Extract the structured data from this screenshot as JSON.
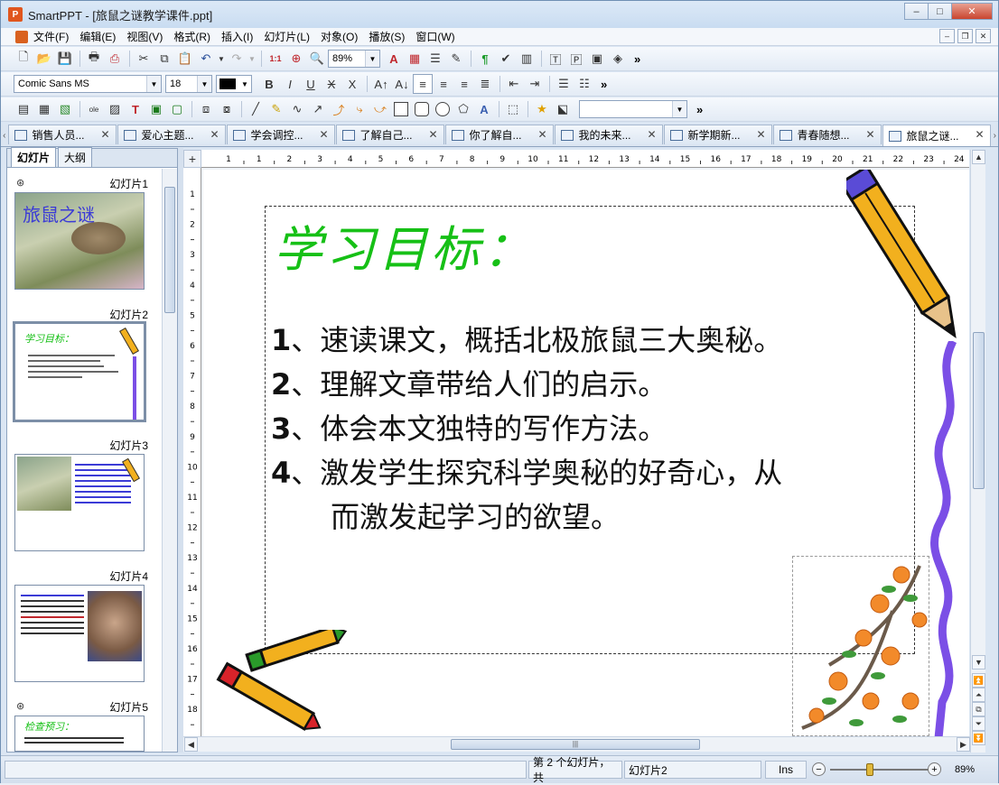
{
  "app": {
    "name": "SmartPPT",
    "title": "SmartPPT - [旅鼠之谜教学课件.ppt]",
    "icon_letter": "P"
  },
  "window_controls": {
    "minimize": "–",
    "maximize": "□",
    "close": "✕"
  },
  "mdi_controls": {
    "minimize": "–",
    "restore": "❐",
    "close": "✕"
  },
  "menu": [
    "文件(F)",
    "编辑(E)",
    "视图(V)",
    "格式(R)",
    "插入(I)",
    "幻灯片(L)",
    "对象(O)",
    "播放(S)",
    "窗口(W)"
  ],
  "toolbar": {
    "zoom": "89%",
    "font_name": "Comic Sans MS",
    "font_size": "18",
    "text_color": "#000000",
    "more": "»"
  },
  "doc_tabs": [
    {
      "label": "销售人员...",
      "active": false
    },
    {
      "label": "爱心主题...",
      "active": false
    },
    {
      "label": "学会调控...",
      "active": false
    },
    {
      "label": "了解自己...",
      "active": false
    },
    {
      "label": "你了解自...",
      "active": false
    },
    {
      "label": "我的未来...",
      "active": false
    },
    {
      "label": "新学期新...",
      "active": false
    },
    {
      "label": "青春随想...",
      "active": false
    },
    {
      "label": "旅鼠之谜...",
      "active": true
    }
  ],
  "left_panel": {
    "tabs": [
      "幻灯片",
      "大纲"
    ],
    "slides": [
      {
        "label": "幻灯片1",
        "thumb_title": "旅鼠之谜"
      },
      {
        "label": "幻灯片2",
        "thumb_title": "学习目标："
      },
      {
        "label": "幻灯片3",
        "thumb_title": ""
      },
      {
        "label": "幻灯片4",
        "thumb_title": ""
      },
      {
        "label": "幻灯片5",
        "thumb_title": "检查预习："
      }
    ]
  },
  "ruler": {
    "h_numbers": [
      "1",
      "1",
      "2",
      "3",
      "4",
      "5",
      "6",
      "7",
      "8",
      "9",
      "10",
      "11",
      "12",
      "13",
      "14",
      "15",
      "16",
      "17",
      "18",
      "19",
      "20",
      "21",
      "22",
      "23",
      "24",
      "25"
    ],
    "v_numbers": [
      "1",
      "2",
      "3",
      "4",
      "5",
      "6",
      "7",
      "8",
      "9",
      "10",
      "11",
      "12",
      "13",
      "14",
      "15",
      "16",
      "17",
      "18"
    ]
  },
  "slide": {
    "title": "学习目标：",
    "goals": [
      {
        "num": "1",
        "text": "、速读课文，概括北极旅鼠三大奥秘。"
      },
      {
        "num": "2",
        "text": "、理解文章带给人们的启示。"
      },
      {
        "num": "3",
        "text": "、体会本文独特的写作方法。"
      },
      {
        "num": "4",
        "text": "、激发学生探究科学奥秘的好奇心，从"
      }
    ],
    "goal_continuation": "而激发起学习的欲望。"
  },
  "statusbar": {
    "slide_info": "第 2 个幻灯片，共",
    "slide_name": "幻灯片2",
    "mode": "Ins",
    "zoom": "89%"
  },
  "colors": {
    "title_green": "#16c016",
    "accent_orange": "#e0561e",
    "squiggle_purple": "#7b4fe6"
  }
}
